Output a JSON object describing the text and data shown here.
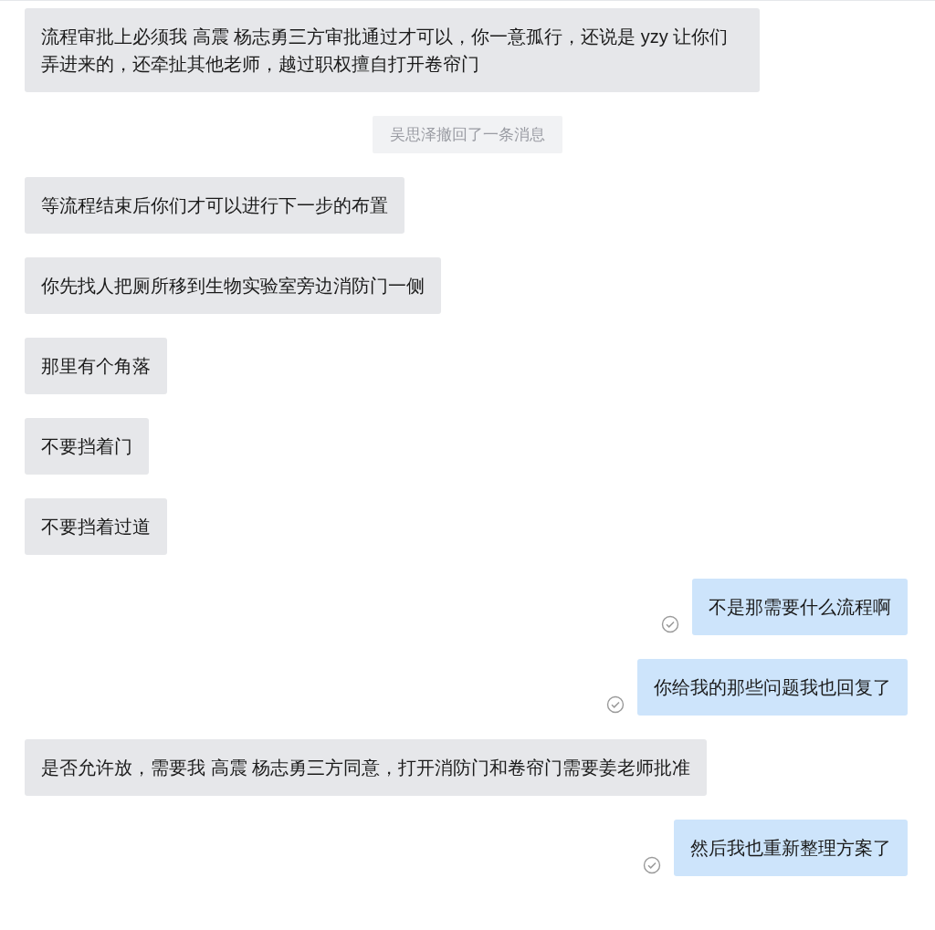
{
  "messages": [
    {
      "kind": "incoming",
      "text": "流程审批上必须我 高震 杨志勇三方审批通过才可以，你一意孤行，还说是 yzy 让你们弄进来的，还牵扯其他老师，越过职权擅自打开卷帘门"
    },
    {
      "kind": "notice",
      "text": "吴思泽撤回了一条消息"
    },
    {
      "kind": "incoming",
      "text": "等流程结束后你们才可以进行下一步的布置"
    },
    {
      "kind": "incoming",
      "text": "你先找人把厕所移到生物实验室旁边消防门一侧"
    },
    {
      "kind": "incoming",
      "text": "那里有个角落"
    },
    {
      "kind": "incoming",
      "text": "不要挡着门"
    },
    {
      "kind": "incoming",
      "text": "不要挡着过道"
    },
    {
      "kind": "outgoing",
      "text": "不是那需要什么流程啊",
      "read": true
    },
    {
      "kind": "outgoing",
      "text": "你给我的那些问题我也回复了",
      "read": true
    },
    {
      "kind": "incoming",
      "text": "是否允许放，需要我 高震 杨志勇三方同意，打开消防门和卷帘门需要姜老师批准"
    },
    {
      "kind": "outgoing",
      "text": "然后我也重新整理方案了",
      "read": true
    }
  ]
}
